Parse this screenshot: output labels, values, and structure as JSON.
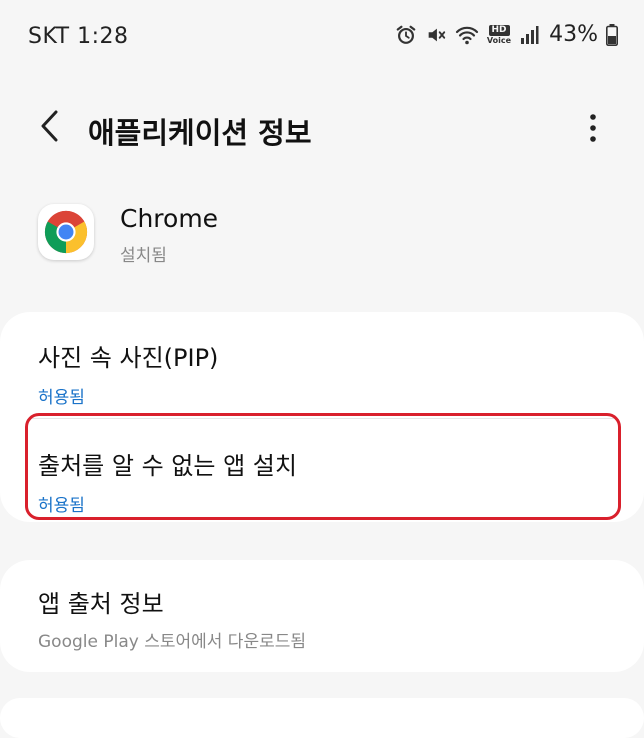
{
  "status_bar": {
    "carrier_time": "SKT 1:28",
    "battery": "43%",
    "hd_label": "HD",
    "voice_label": "Voice"
  },
  "header": {
    "title": "애플리케이션 정보"
  },
  "app": {
    "name": "Chrome",
    "status": "설치됨"
  },
  "settings": {
    "pip": {
      "title": "사진 속 사진(PIP)",
      "value": "허용됨"
    },
    "unknown_sources": {
      "title": "출처를 알 수 없는 앱 설치",
      "value": "허용됨"
    }
  },
  "source_info": {
    "title": "앱 출처 정보",
    "value": "Google Play 스토어에서 다운로드됨"
  },
  "colors": {
    "accent_link": "#1a73c9",
    "highlight_border": "#d9202c",
    "background": "#f6f6f6",
    "card": "#ffffff"
  },
  "icons": [
    "alarm-icon",
    "mute-icon",
    "wifi-icon",
    "signal-icon",
    "battery-icon",
    "back-icon",
    "more-vert-icon",
    "chrome-icon"
  ]
}
